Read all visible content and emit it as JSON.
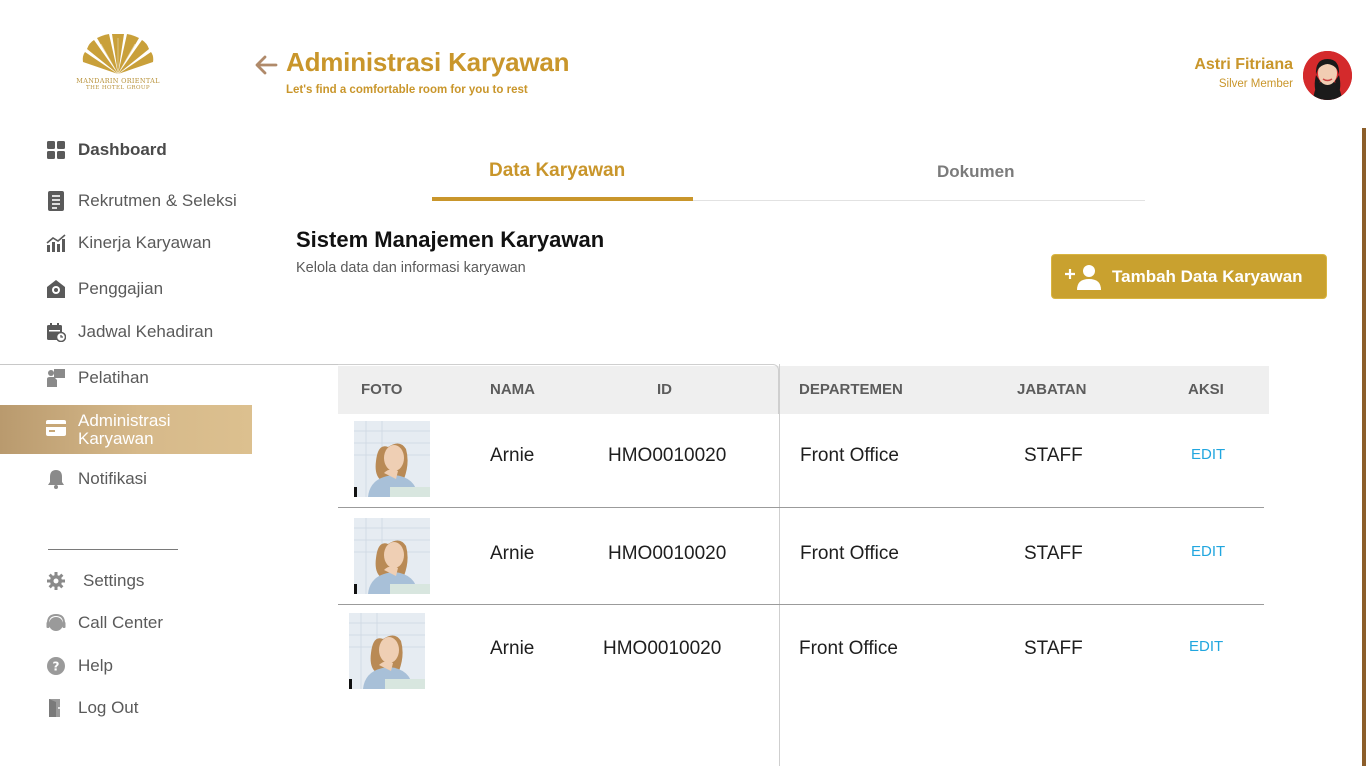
{
  "brand": {
    "line1": "MANDARIN ORIENTAL",
    "line2": "THE HOTEL GROUP",
    "color": "#c9962b"
  },
  "header": {
    "title": "Administrasi Karyawan",
    "subtitle": "Let's find a comfortable room for you to rest",
    "back_icon": "arrow-left-icon"
  },
  "user": {
    "name": "Astri Fitriana",
    "tier": "Silver Member"
  },
  "sidebar": {
    "items": [
      {
        "label": "Dashboard",
        "icon": "grid-icon"
      },
      {
        "label": "Rekrutmen & Seleksi",
        "icon": "list-icon"
      },
      {
        "label": "Kinerja Karyawan",
        "icon": "chart-icon"
      },
      {
        "label": "Penggajian",
        "icon": "payroll-icon"
      },
      {
        "label": "Jadwal Kehadiran",
        "icon": "calendar-icon"
      },
      {
        "label": "Pelatihan",
        "icon": "training-icon"
      },
      {
        "label": "Administrasi Karyawan",
        "icon": "card-icon",
        "active": true
      },
      {
        "label": "Notifikasi",
        "icon": "bell-icon"
      }
    ],
    "footer_items": [
      {
        "label": "Settings",
        "icon": "gear-icon"
      },
      {
        "label": "Call Center",
        "icon": "headset-icon"
      },
      {
        "label": "Help",
        "icon": "help-icon"
      },
      {
        "label": "Log Out",
        "icon": "logout-icon"
      }
    ]
  },
  "tabs": [
    {
      "label": "Data Karyawan",
      "active": true
    },
    {
      "label": "Dokumen",
      "active": false
    }
  ],
  "section": {
    "title": "Sistem Manajemen Karyawan",
    "subtitle": "Kelola data dan informasi karyawan",
    "add_button": "Tambah Data Karyawan"
  },
  "table": {
    "columns": [
      "FOTO",
      "NAMA",
      "ID",
      "DEPARTEMEN",
      "JABATAN",
      "AKSI"
    ],
    "rows": [
      {
        "nama": "Arnie",
        "id": "HMO0010020",
        "departemen": "Front Office",
        "jabatan": "STAFF",
        "aksi": "EDIT"
      },
      {
        "nama": "Arnie",
        "id": "HMO0010020",
        "departemen": "Front Office",
        "jabatan": "STAFF",
        "aksi": "EDIT"
      },
      {
        "nama": "Arnie",
        "id": "HMO0010020",
        "departemen": "Front Office",
        "jabatan": "STAFF",
        "aksi": "EDIT"
      }
    ]
  },
  "colors": {
    "accent": "#c9962b",
    "button": "#c9a12f",
    "link": "#21a6df"
  }
}
